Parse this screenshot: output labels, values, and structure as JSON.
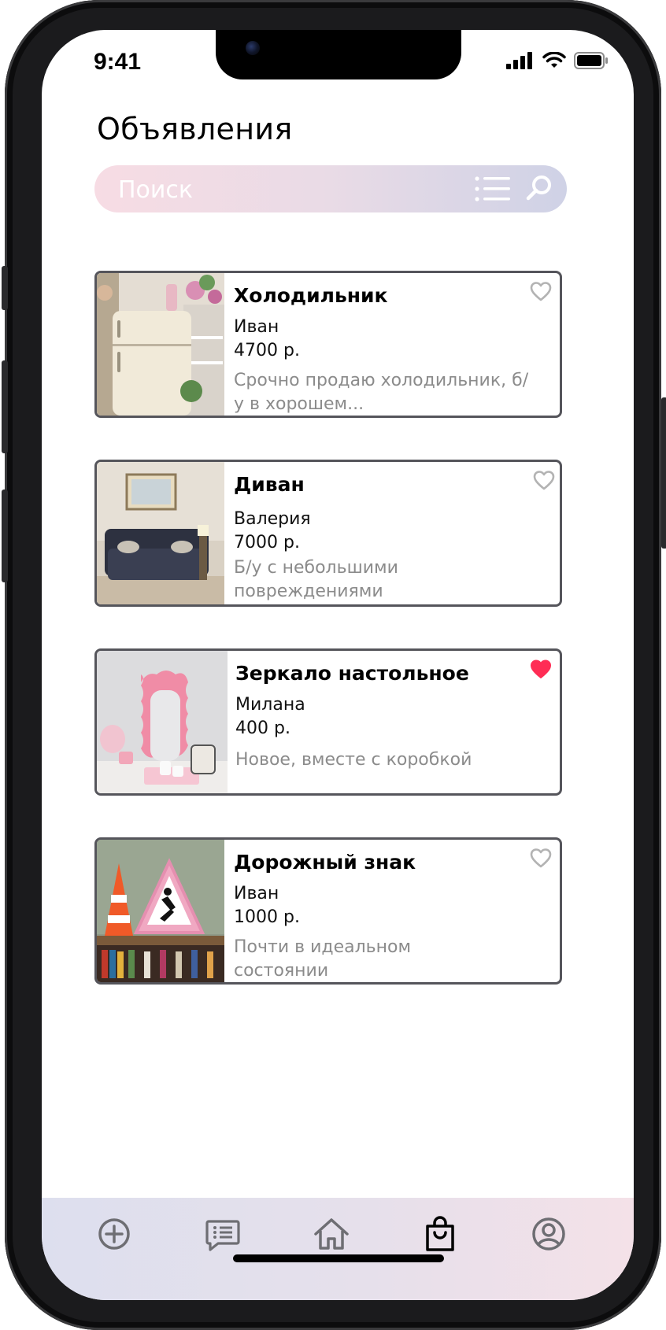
{
  "status_bar": {
    "time": "9:41"
  },
  "header": {
    "title": "Объявления"
  },
  "search": {
    "placeholder": "Поиск"
  },
  "listings": [
    {
      "title": "Холодильник",
      "seller": "Иван",
      "price": "4700 р.",
      "description": "Срочно продаю холодильник, б/у в хорошем...",
      "favorite": false,
      "image": "fridge-photo"
    },
    {
      "title": "Диван",
      "seller": "Валерия",
      "price": "7000 р.",
      "description": "Б/у с небольшими повреждениями",
      "favorite": false,
      "image": "sofa-photo"
    },
    {
      "title": "Зеркало настольное",
      "seller": "Милана",
      "price": "400 р.",
      "description": "Новое, вместе с коробкой",
      "favorite": true,
      "image": "mirror-photo"
    },
    {
      "title": "Дорожный знак",
      "seller": "Иван",
      "price": "1000 р.",
      "description": "Почти в идеальном состоянии",
      "favorite": false,
      "image": "road-sign-photo"
    }
  ],
  "tabbar": {
    "items": [
      {
        "icon": "add-circle-icon",
        "active": false
      },
      {
        "icon": "listings-icon",
        "active": false
      },
      {
        "icon": "home-icon",
        "active": false
      },
      {
        "icon": "shopping-bag-icon",
        "active": true
      },
      {
        "icon": "profile-icon",
        "active": false
      }
    ]
  },
  "colors": {
    "favorite_active": "#ff2d55",
    "favorite_inactive": "#b3b3b3",
    "tab_inactive": "#6e6e73",
    "tab_active": "#000000",
    "card_border": "#55555b"
  }
}
